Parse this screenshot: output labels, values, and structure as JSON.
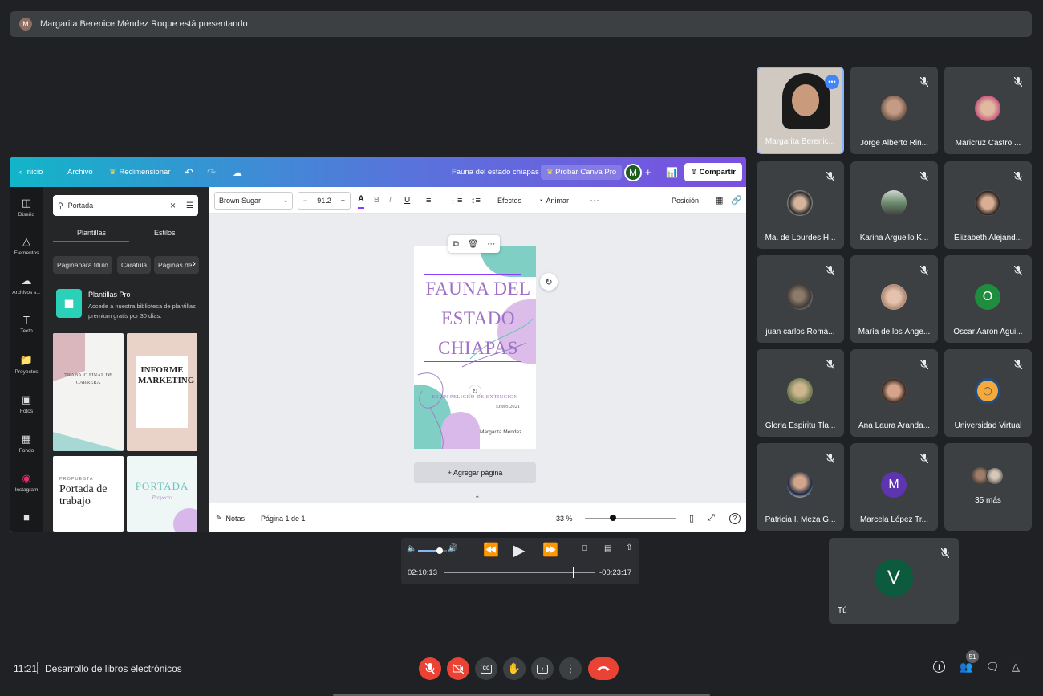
{
  "banner": {
    "avatar_letter": "M",
    "text": "Margarita Berenice Méndez Roque está presentando"
  },
  "canva": {
    "topbar": {
      "home": "Inicio",
      "file": "Archivo",
      "resize": "Redimensionar",
      "doc_title": "Fauna del estado chiapas",
      "try_pro": "Probar Canva Pro",
      "avatar": "M",
      "share": "Compartir"
    },
    "rail": [
      "Diseño",
      "Elementos",
      "Archivos s...",
      "Texto",
      "Proyectos",
      "Fotos",
      "Fondo",
      "Instagram"
    ],
    "panel": {
      "search_value": "Portada",
      "tab_templates": "Plantillas",
      "tab_styles": "Estilos",
      "chips": [
        "Paginapara titulo",
        "Caratula",
        "Páginas de"
      ],
      "pro_title": "Plantillas Pro",
      "pro_desc": "Accede a nuestra biblioteca de plantillas premium gratis por 30 días.",
      "thumb1": "TRABAJO FINAL DE CARRERA",
      "thumb2": "INFORME MARKETING",
      "thumb3_small": "PROPUESTA",
      "thumb3": "Portada de trabajo",
      "thumb4": "PORTADA",
      "thumb4_sub": "Proyecto"
    },
    "toolbar": {
      "font": "Brown Sugar",
      "size": "91.2",
      "effects": "Efectos",
      "animate": "Animar",
      "position": "Posición"
    },
    "page": {
      "title_line1": "FAUNA DEL",
      "title_line2": "ESTADO",
      "title_line3": "CHIAPAS",
      "subtitle": "ES EN PELIGRO DE EXTINCION",
      "date": "Enero 2021",
      "author": "Margarita Méndez"
    },
    "add_page": "+ Agregar página",
    "bottom": {
      "notes": "Notas",
      "page_info": "Página 1 de 1",
      "zoom": "33 %"
    }
  },
  "media": {
    "elapsed": "02:10:13",
    "remaining": "-00:23:17",
    "volume_level": 0.75,
    "progress": 0.85
  },
  "participants": [
    {
      "name": "Margarita Berenic...",
      "kind": "video"
    },
    {
      "name": "Jorge Alberto Rin...",
      "kind": "photo"
    },
    {
      "name": "Maricruz Castro ...",
      "kind": "photo"
    },
    {
      "name": "Ma. de Lourdes H...",
      "kind": "photo"
    },
    {
      "name": "Karina Arguello K...",
      "kind": "photo"
    },
    {
      "name": "Elizabeth Alejand...",
      "kind": "photo"
    },
    {
      "name": "juan carlos Romà...",
      "kind": "photo"
    },
    {
      "name": "María de los Ánge...",
      "kind": "photo"
    },
    {
      "name": "Oscar Aaron Agui...",
      "kind": "letter",
      "letter": "O",
      "color": "#1e8e3e"
    },
    {
      "name": "Gloria Espiritu Tla...",
      "kind": "photo"
    },
    {
      "name": "Ana Laura Aranda...",
      "kind": "photo"
    },
    {
      "name": "Universidad Virtual",
      "kind": "logo"
    },
    {
      "name": "Patricia I. Meza G...",
      "kind": "photo"
    },
    {
      "name": "Marcela López Tr...",
      "kind": "letter",
      "letter": "M",
      "color": "#5e35b1"
    },
    {
      "name": "35 más",
      "kind": "more"
    }
  ],
  "self_tile": {
    "name": "Tú",
    "letter": "V",
    "color": "#0d5b3f"
  },
  "bottombar": {
    "time": "11:21",
    "meeting": "Desarrollo de libros electrónicos",
    "people_count": "51"
  }
}
